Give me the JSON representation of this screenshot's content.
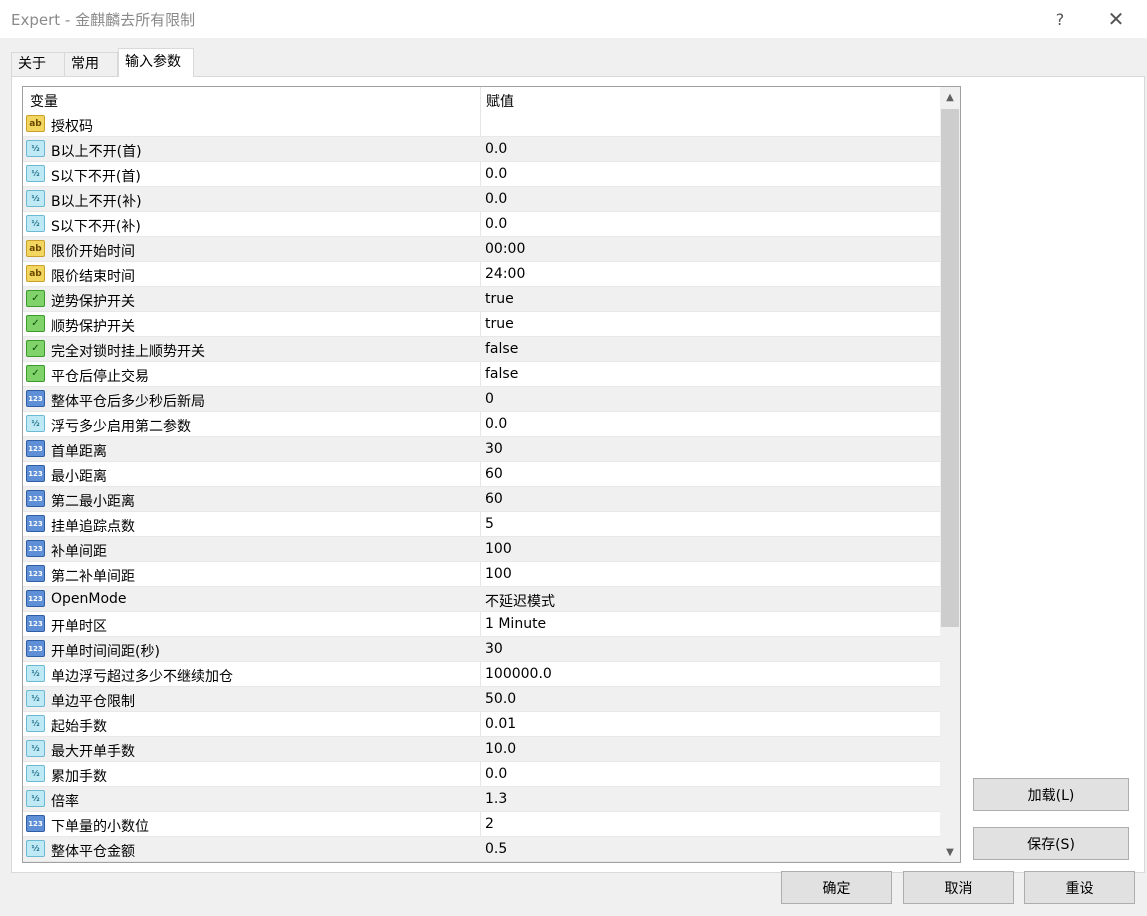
{
  "window": {
    "title": "Expert - 金麒麟去所有限制",
    "help_label": "?",
    "close_label": "✕"
  },
  "tabs": [
    {
      "label": "关于"
    },
    {
      "label": "常用"
    },
    {
      "label": "输入参数"
    }
  ],
  "grid": {
    "col_variable": "变量",
    "col_value": "赋值",
    "rows": [
      {
        "icon": "string-icon",
        "name": "授权码",
        "value": ""
      },
      {
        "icon": "double-icon",
        "name": "B以上不开(首)",
        "value": "0.0"
      },
      {
        "icon": "double-icon",
        "name": "S以下不开(首)",
        "value": "0.0"
      },
      {
        "icon": "double-icon",
        "name": "B以上不开(补)",
        "value": "0.0"
      },
      {
        "icon": "double-icon",
        "name": "S以下不开(补)",
        "value": "0.0"
      },
      {
        "icon": "string-icon",
        "name": "限价开始时间",
        "value": "00:00"
      },
      {
        "icon": "string-icon",
        "name": "限价结束时间",
        "value": "24:00"
      },
      {
        "icon": "bool-icon",
        "name": "逆势保护开关",
        "value": "true"
      },
      {
        "icon": "bool-icon",
        "name": "顺势保护开关",
        "value": "true"
      },
      {
        "icon": "bool-icon",
        "name": "完全对锁时挂上顺势开关",
        "value": "false"
      },
      {
        "icon": "bool-icon",
        "name": "平仓后停止交易",
        "value": "false"
      },
      {
        "icon": "int-icon",
        "name": "整体平仓后多少秒后新局",
        "value": "0"
      },
      {
        "icon": "double-icon",
        "name": "浮亏多少启用第二参数",
        "value": "0.0"
      },
      {
        "icon": "int-icon",
        "name": "首单距离",
        "value": "30"
      },
      {
        "icon": "int-icon",
        "name": "最小距离",
        "value": "60"
      },
      {
        "icon": "int-icon",
        "name": "第二最小距离",
        "value": "60"
      },
      {
        "icon": "int-icon",
        "name": "挂单追踪点数",
        "value": "5"
      },
      {
        "icon": "int-icon",
        "name": "补单间距",
        "value": "100"
      },
      {
        "icon": "int-icon",
        "name": "第二补单间距",
        "value": "100"
      },
      {
        "icon": "int-icon",
        "name": "OpenMode",
        "value": "不延迟模式"
      },
      {
        "icon": "int-icon",
        "name": "开单时区",
        "value": "1 Minute"
      },
      {
        "icon": "int-icon",
        "name": "开单时间间距(秒)",
        "value": "30"
      },
      {
        "icon": "double-icon",
        "name": "单边浮亏超过多少不继续加仓",
        "value": "100000.0"
      },
      {
        "icon": "double-icon",
        "name": "单边平仓限制",
        "value": "50.0"
      },
      {
        "icon": "double-icon",
        "name": "起始手数",
        "value": "0.01"
      },
      {
        "icon": "double-icon",
        "name": "最大开单手数",
        "value": "10.0"
      },
      {
        "icon": "double-icon",
        "name": "累加手数",
        "value": "0.0"
      },
      {
        "icon": "double-icon",
        "name": "倍率",
        "value": "1.3"
      },
      {
        "icon": "int-icon",
        "name": "下单量的小数位",
        "value": "2"
      },
      {
        "icon": "double-icon",
        "name": "整体平仓金额",
        "value": "0.5"
      }
    ]
  },
  "buttons": {
    "load": "加载(L)",
    "save": "保存(S)",
    "ok": "确定",
    "cancel": "取消",
    "reset": "重设"
  }
}
